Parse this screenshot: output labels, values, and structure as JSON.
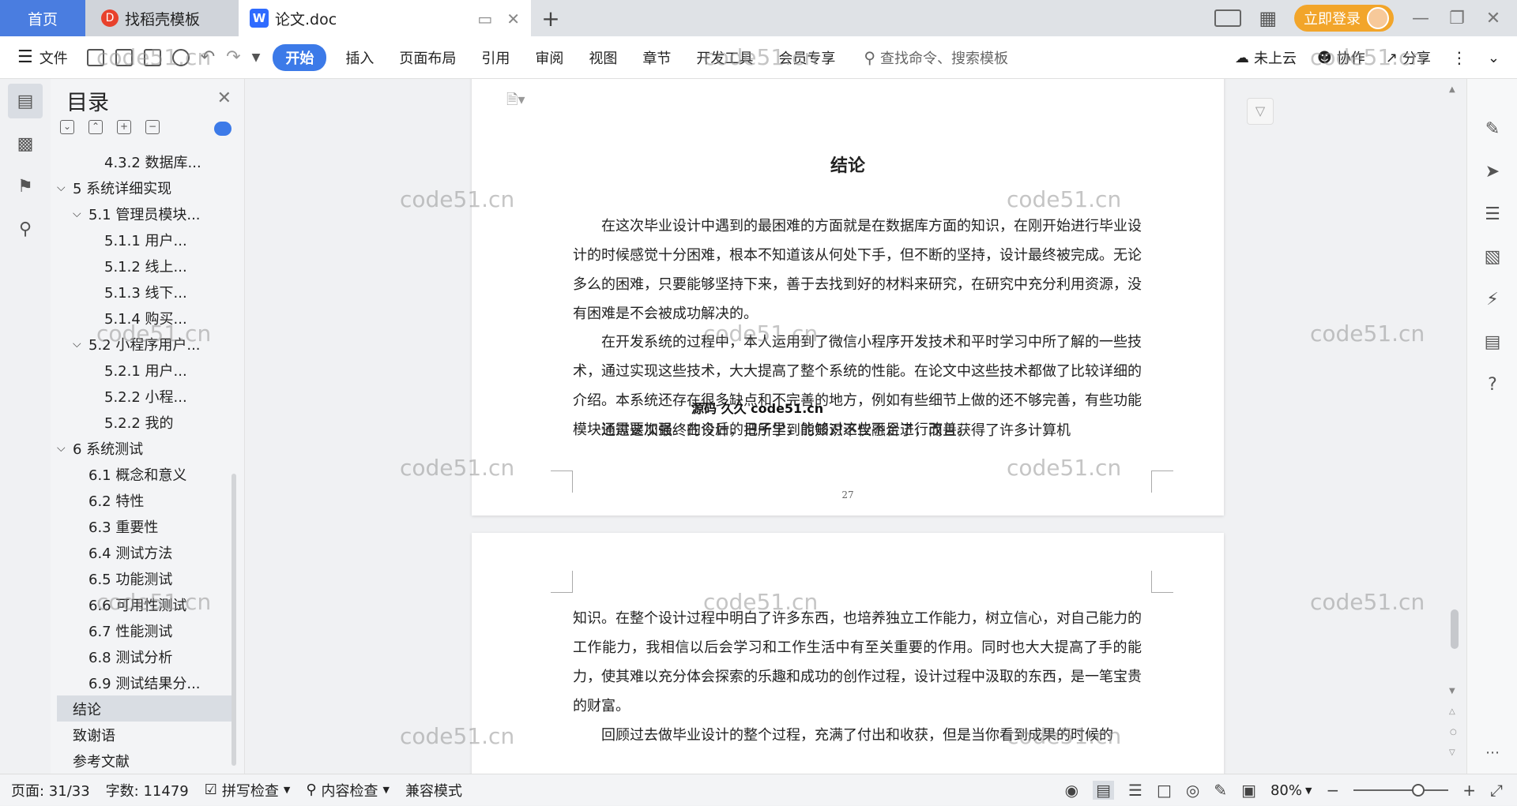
{
  "titlebar": {
    "home_tab": "首页",
    "template_tab": "找稻壳模板",
    "doc_tab": "论文.doc",
    "login_button": "立即登录"
  },
  "ribbon": {
    "file_menu": "文件",
    "tabs": [
      "开始",
      "插入",
      "页面布局",
      "引用",
      "审阅",
      "视图",
      "章节",
      "开发工具",
      "会员专享"
    ],
    "search_placeholder": "查找命令、搜索模板",
    "cloud_status": "未上云",
    "collaborate": "协作",
    "share": "分享"
  },
  "toc": {
    "title": "目录",
    "items": [
      {
        "label": "4.3.2 数据库...",
        "level": 3
      },
      {
        "label": "5 系统详细实现",
        "level": 1
      },
      {
        "label": "5.1 管理员模块...",
        "level": 2
      },
      {
        "label": "5.1.1 用户...",
        "level": 3
      },
      {
        "label": "5.1.2 线上...",
        "level": 3
      },
      {
        "label": "5.1.3 线下...",
        "level": 3
      },
      {
        "label": "5.1.4 购买...",
        "level": 3
      },
      {
        "label": "5.2 小程序用户...",
        "level": 2
      },
      {
        "label": "5.2.1 用户...",
        "level": 3
      },
      {
        "label": "5.2.2 小程...",
        "level": 3
      },
      {
        "label": "5.2.2 我的",
        "level": 3
      },
      {
        "label": "6 系统测试",
        "level": 1
      },
      {
        "label": "6.1 概念和意义",
        "level": 2
      },
      {
        "label": "6.2 特性",
        "level": 2
      },
      {
        "label": "6.3 重要性",
        "level": 2
      },
      {
        "label": "6.4 测试方法",
        "level": 2
      },
      {
        "label": "6.5 功能测试",
        "level": 2
      },
      {
        "label": "6.6 可用性测试",
        "level": 2
      },
      {
        "label": "6.7 性能测试",
        "level": 2
      },
      {
        "label": "6.8 测试分析",
        "level": 2
      },
      {
        "label": "6.9 测试结果分...",
        "level": 2
      },
      {
        "label": "结论",
        "level": 1
      },
      {
        "label": "致谢语",
        "level": 1
      },
      {
        "label": "参考文献",
        "level": 1
      }
    ]
  },
  "document": {
    "heading": "结论",
    "page1_paragraphs": [
      "在这次毕业设计中遇到的最困难的方面就是在数据库方面的知识，在刚开始进行毕业设计的时候感觉十分困难，根本不知道该从何处下手，但不断的坚持，设计最终被完成。无论多么的困难，只要能够坚持下来，善于去找到好的材料来研究，在研究中充分利用资源，没有困难是不会被成功解决的。",
      "在开发系统的过程中，本人运用到了微信小程序开发技术和平时学习中所了解的一些技术，通过实现这些技术，大大提高了整个系统的性能。在论文中这些技术都做了比较详细的介绍。本系统还存在很多缺点和不完善的地方，例如有些细节上做的还不够完善，有些功能模块还需要加强。在今后的日子里，能够对这些不足进行改善。",
      "通过这次最终的设计，把所学到的知识不仅融合了，而且获得了许多计算机"
    ],
    "overlay_text": "源码 久久 code51.cn",
    "page_number": "27",
    "page2_paragraphs": [
      "知识。在整个设计过程中明白了许多东西，也培养独立工作能力，树立信心，对自己能力的工作能力，我相信以后会学习和工作生活中有至关重要的作用。同时也大大提高了手的能力，使其难以充分体会探索的乐趣和成功的创作过程，设计过程中汲取的东西，是一笔宝贵的财富。",
      "回顾过去做毕业设计的整个过程，充满了付出和收获，但是当你看到成果的时候的"
    ]
  },
  "watermark": "code51.cn",
  "statusbar": {
    "page": "页面: 31/33",
    "words": "字数: 11479",
    "spell_check": "拼写检查",
    "content_check": "内容检查",
    "compat_mode": "兼容模式",
    "zoom": "80%"
  }
}
